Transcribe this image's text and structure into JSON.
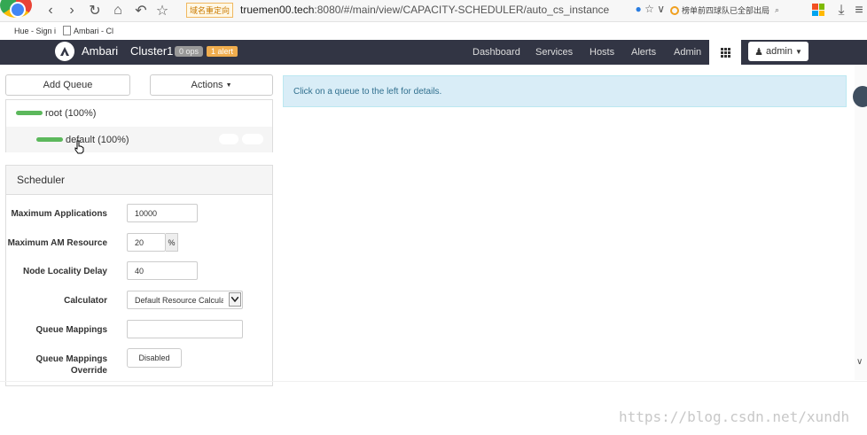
{
  "browser": {
    "url_tag": "域名重定向",
    "url_host": "truemen00.tech",
    "url_rest": ":8080/#/main/view/CAPACITY-SCHEDULER/auto_cs_instance",
    "search_text": "榜单前四球队已全部出局",
    "bookmarks": [
      "Hue - Sign i",
      "Ambari - Cl"
    ]
  },
  "navbar": {
    "brand": "Ambari",
    "cluster": "Cluster1",
    "ops_badge": "0 ops",
    "alert_badge": "1 alert",
    "links": [
      "Dashboard",
      "Services",
      "Hosts",
      "Alerts",
      "Admin"
    ],
    "user_menu": "admin"
  },
  "toolbar": {
    "add_queue": "Add Queue",
    "actions": "Actions"
  },
  "queues": [
    {
      "label": "root (100%)",
      "capacity": 1.0
    },
    {
      "label": "default (100%)",
      "capacity": 1.0
    }
  ],
  "scheduler": {
    "title": "Scheduler",
    "fields": {
      "max_apps_label": "Maximum Applications",
      "max_apps_value": "10000",
      "max_am_label": "Maximum AM Resource",
      "max_am_value": "20",
      "max_am_unit": "%",
      "locality_label": "Node Locality Delay",
      "locality_value": "40",
      "calculator_label": "Calculator",
      "calculator_value": "Default Resource Calculator",
      "mappings_label": "Queue Mappings",
      "mappings_value": "",
      "override_label_1": "Queue Mappings",
      "override_label_2": "Override",
      "override_button": "Disabled"
    }
  },
  "main": {
    "info": "Click on a queue to the left for details."
  },
  "watermark": "https://blog.csdn.net/xundh"
}
